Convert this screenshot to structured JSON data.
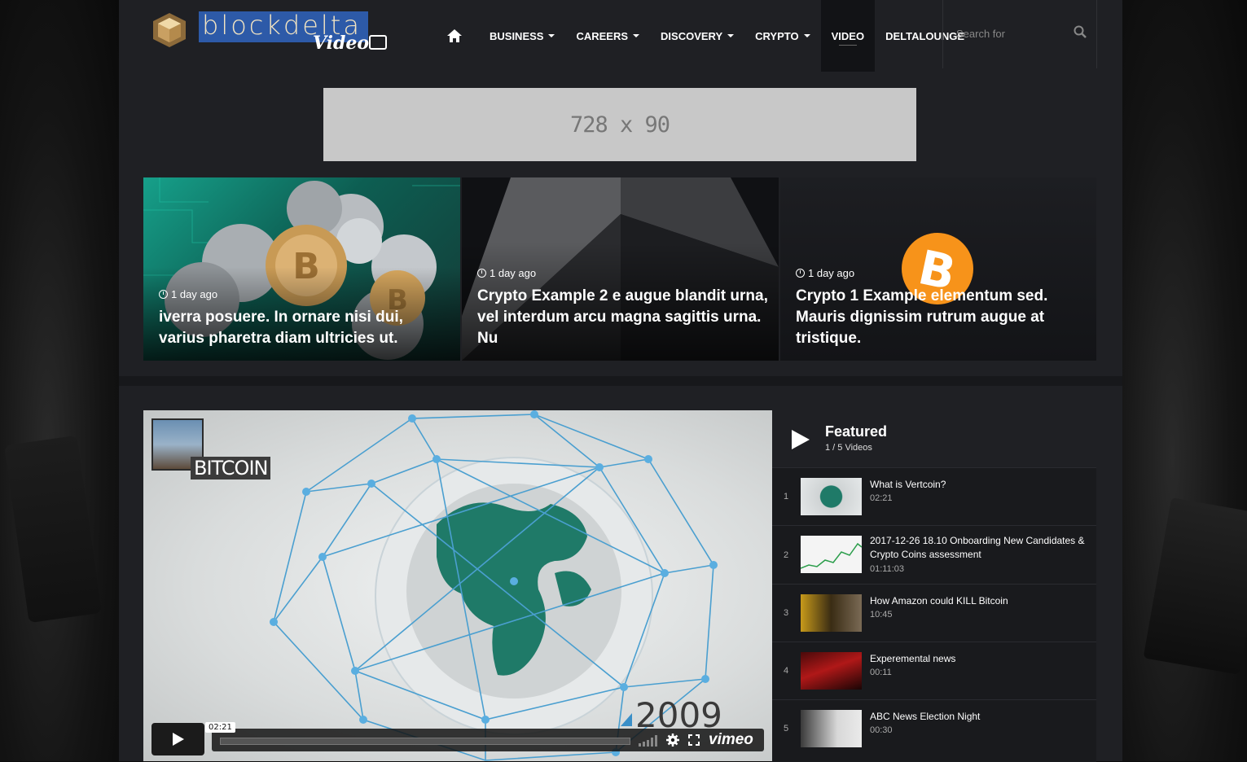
{
  "logo": {
    "main": "blockdelta",
    "sub": "Video"
  },
  "nav": {
    "items": [
      {
        "label": "BUSINESS",
        "caret": true
      },
      {
        "label": "CAREERS",
        "caret": true
      },
      {
        "label": "DISCOVERY",
        "caret": true
      },
      {
        "label": "CRYPTO",
        "caret": true
      },
      {
        "label": "VIDEO",
        "caret": false,
        "active": true
      },
      {
        "label": "DELTALOUNGE",
        "caret": false
      }
    ]
  },
  "search": {
    "placeholder": "Search for"
  },
  "ad": {
    "label": "728 x 90"
  },
  "slides": [
    {
      "meta": "1 day ago",
      "title": "iverra posuere. In ornare nisi dui, varius pharetra diam ultricies ut."
    },
    {
      "meta": "1 day ago",
      "title": "Crypto Example 2 e augue blandit urna, vel interdum arcu magna sagittis urna. Nu"
    },
    {
      "meta": "1 day ago",
      "title": "Crypto 1 Example elementum sed. Mauris dignissim rutrum augue at tristique."
    }
  ],
  "player": {
    "overlay_title": "BITCOIN",
    "year": "2009",
    "time": "02:21",
    "brand": "vimeo"
  },
  "playlist": {
    "title": "Featured",
    "count": "1 / 5 Videos",
    "items": [
      {
        "num": "1",
        "title": "What is Vertcoin?",
        "duration": "02:21"
      },
      {
        "num": "2",
        "title": "2017-12-26 18.10 Onboarding New Candidates & Crypto Coins assessment",
        "duration": "01:11:03"
      },
      {
        "num": "3",
        "title": "How Amazon could KILL Bitcoin",
        "duration": "10:45"
      },
      {
        "num": "4",
        "title": "Experemental news",
        "duration": "00:11"
      },
      {
        "num": "5",
        "title": "ABC News Election Night",
        "duration": "00:30"
      }
    ]
  },
  "colors": {
    "page_bg": "#1f2024",
    "accent_blue": "#2d5aa8",
    "nav_active": "#121316",
    "bitcoin_orange": "#f7931a"
  }
}
